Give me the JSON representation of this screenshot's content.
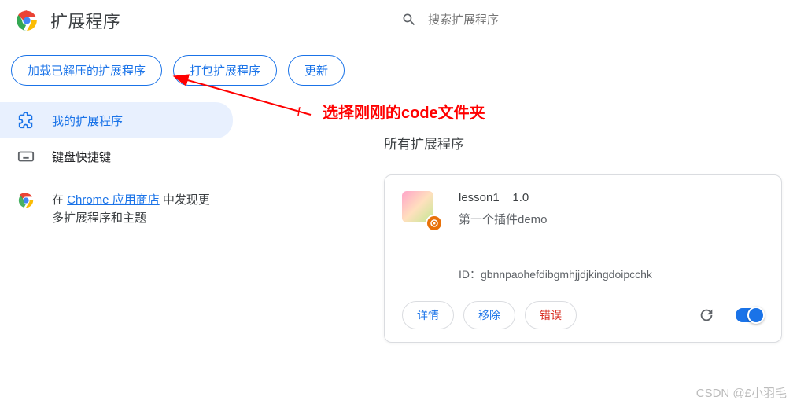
{
  "header": {
    "title": "扩展程序"
  },
  "search": {
    "placeholder": "搜索扩展程序"
  },
  "toolbar": {
    "load_unpacked": "加载已解压的扩展程序",
    "pack": "打包扩展程序",
    "update": "更新"
  },
  "annotation": {
    "number": "1",
    "text": "选择刚刚的code文件夹"
  },
  "sidebar": {
    "my_extensions": "我的扩展程序",
    "shortcuts": "键盘快捷键",
    "store_prefix": "在 ",
    "store_link": "Chrome 应用商店",
    "store_suffix": " 中发现更多扩展程序和主题"
  },
  "content": {
    "heading": "所有扩展程序"
  },
  "extension": {
    "name": "lesson1",
    "version": "1.0",
    "description": "第一个插件demo",
    "id_label": "ID：",
    "id_value": "gbnnpaohefdibgmhjjdjkingdoipcchk",
    "details": "详情",
    "remove": "移除",
    "errors": "错误"
  },
  "watermark": "CSDN @£小羽毛"
}
